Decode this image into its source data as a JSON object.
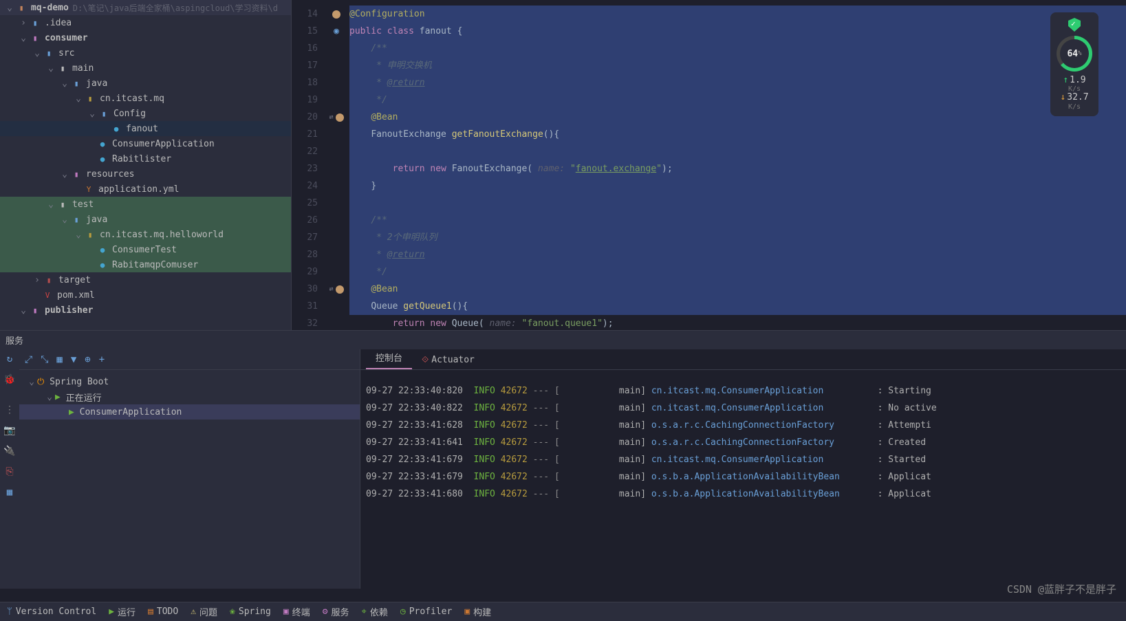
{
  "tree": {
    "root": {
      "name": "mq-demo",
      "path": "D:\\笔记\\java后端全家桶\\aspingcloud\\学习资料\\d"
    },
    "idea": ".idea",
    "consumer": "consumer",
    "src": "src",
    "main": "main",
    "java": "java",
    "pkg": "cn.itcast.mq",
    "config": "Config",
    "fanout": "fanout",
    "consumerApp": "ConsumerApplication",
    "rabit": "Rabitlister",
    "resources": "resources",
    "appyml": "application.yml",
    "test": "test",
    "javaT": "java",
    "pkgT": "cn.itcast.mq.helloworld",
    "consumerTest": "ConsumerTest",
    "rabitamqp": "RabitamqpComuser",
    "target": "target",
    "pom": "pom.xml",
    "publisher": "publisher"
  },
  "gutter": [
    "14",
    "15",
    "16",
    "17",
    "18",
    "19",
    "20",
    "21",
    "22",
    "23",
    "24",
    "25",
    "26",
    "27",
    "28",
    "29",
    "30",
    "31",
    "32"
  ],
  "code": {
    "ann": "@Configuration",
    "cls": [
      "public ",
      "class ",
      "fanout ",
      "{"
    ],
    "cm_open": "/**",
    "cm1": " * 申明交换机",
    "ret": " * ",
    "ret_tag": "@return",
    "cm_close": " */",
    "bean": "@Bean",
    "m1": [
      "FanoutExchange ",
      "getFanoutExchange",
      "(){"
    ],
    "rtn": [
      "return ",
      "new ",
      "FanoutExchange( ",
      "name: ",
      "\"",
      "fanout.exchange",
      "\"",
      ");"
    ],
    "brace": "}",
    "cm2": " * 2个申明队列",
    "m2": [
      "Queue ",
      "getQueue1",
      "(){"
    ],
    "rtn2": [
      "return ",
      "new ",
      "Queue( ",
      "name: ",
      "\"fanout.queue1\"",
      ");"
    ]
  },
  "monitor": {
    "pct": "64",
    "up": "1.9",
    "dn": "32.7",
    "unit": "K/s"
  },
  "services": {
    "title": "服务",
    "root": "Spring Boot",
    "running": "正在运行",
    "app": "ConsumerApplication"
  },
  "svc_tabs": {
    "console": "控制台",
    "actuator": "Actuator"
  },
  "logs": [
    {
      "t": "09-27 22:33:40:820",
      "lvl": "INFO",
      "pid": "42672",
      "thr": "main]",
      "cls": "cn.itcast.mq.ConsumerApplication",
      "msg": ": Starting"
    },
    {
      "t": "09-27 22:33:40:822",
      "lvl": "INFO",
      "pid": "42672",
      "thr": "main]",
      "cls": "cn.itcast.mq.ConsumerApplication",
      "msg": ": No active"
    },
    {
      "t": "09-27 22:33:41:628",
      "lvl": "INFO",
      "pid": "42672",
      "thr": "main]",
      "cls": "o.s.a.r.c.CachingConnectionFactory",
      "msg": ": Attempti"
    },
    {
      "t": "09-27 22:33:41:641",
      "lvl": "INFO",
      "pid": "42672",
      "thr": "main]",
      "cls": "o.s.a.r.c.CachingConnectionFactory",
      "msg": ": Created "
    },
    {
      "t": "09-27 22:33:41:679",
      "lvl": "INFO",
      "pid": "42672",
      "thr": "main]",
      "cls": "cn.itcast.mq.ConsumerApplication",
      "msg": ": Started "
    },
    {
      "t": "09-27 22:33:41:679",
      "lvl": "INFO",
      "pid": "42672",
      "thr": "main]",
      "cls": "o.s.b.a.ApplicationAvailabilityBean",
      "msg": ": Applicat"
    },
    {
      "t": "09-27 22:33:41:680",
      "lvl": "INFO",
      "pid": "42672",
      "thr": "main]",
      "cls": "o.s.b.a.ApplicationAvailabilityBean",
      "msg": ": Applicat"
    }
  ],
  "status": {
    "vcs": "Version Control",
    "run": "运行",
    "todo": "TODO",
    "problems": "问题",
    "spring": "Spring",
    "terminal": "终端",
    "services": "服务",
    "deps": "依赖",
    "profiler": "Profiler",
    "build": "构建"
  },
  "watermark": "CSDN @蓝胖子不是胖子"
}
